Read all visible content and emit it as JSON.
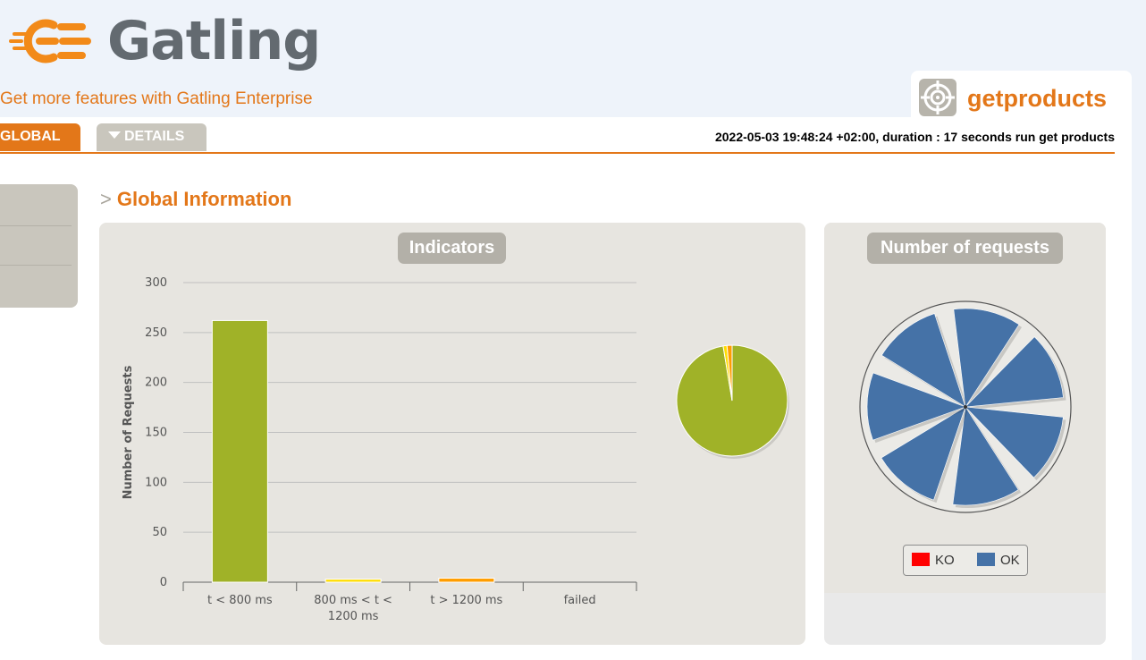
{
  "brand": {
    "name": "Gatling",
    "enterprise_link": "Get more features with Gatling Enterprise"
  },
  "simulation": {
    "name": "getproducts",
    "icon": "target-icon"
  },
  "tabs": [
    {
      "label": "GLOBAL",
      "active": true
    },
    {
      "label": "DETAILS",
      "active": false,
      "icon": "triangle-down-icon"
    }
  ],
  "run_info": "2022-05-03 19:48:24 +02:00, duration : 17 seconds run get products",
  "section": {
    "prefix": ">",
    "title": "Global Information"
  },
  "colors": {
    "accent": "#e37719",
    "ok": "#4572a7",
    "ko": "#ff0000",
    "bar_fast": "#a0b228",
    "bar_mid": "#ffdd00",
    "bar_slow": "#ff9d00",
    "bar_failed": "#ff0000"
  },
  "indicators": {
    "title": "Indicators",
    "ylabel": "Number of Requests",
    "chart_data": {
      "type": "bar",
      "categories": [
        "t < 800 ms",
        "800 ms < t < 1200 ms",
        "t > 1200 ms",
        "failed"
      ],
      "category_lines": [
        [
          "t < 800 ms"
        ],
        [
          "800 ms < t <",
          "1200 ms"
        ],
        [
          "t > 1200 ms"
        ],
        [
          "failed"
        ]
      ],
      "values": [
        262,
        3,
        4,
        0
      ],
      "ylim": [
        0,
        300
      ],
      "yticks": [
        "0",
        "50",
        "100",
        "150",
        "200",
        "250",
        "300"
      ],
      "grid": true
    },
    "pie_chart_data": {
      "type": "pie",
      "categories": [
        "t < 800 ms",
        "800 ms < t < 1200 ms",
        "t > 1200 ms",
        "failed"
      ],
      "values": [
        262,
        3,
        4,
        0
      ]
    }
  },
  "requests": {
    "title": "Number of requests",
    "chart_data": {
      "type": "pie",
      "categories": [
        "KO",
        "OK"
      ],
      "series": [
        {
          "name": "OK",
          "values": [
            1,
            1,
            1,
            1,
            1,
            1,
            1
          ]
        }
      ]
    },
    "legend": [
      {
        "label": "KO"
      },
      {
        "label": "OK"
      }
    ]
  }
}
